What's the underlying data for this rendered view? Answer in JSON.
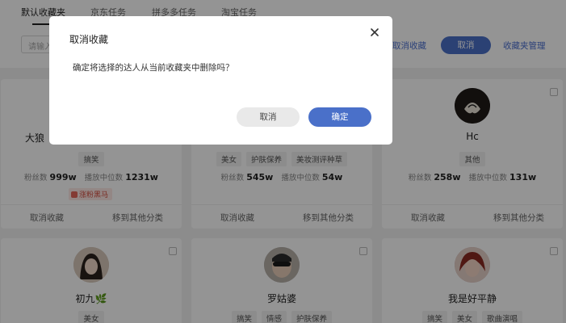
{
  "tabs": [
    {
      "label": "默认收藏夹"
    },
    {
      "label": "京东任务"
    },
    {
      "label": "拼多多任务"
    },
    {
      "label": "淘宝任务"
    }
  ],
  "toolbar": {
    "search_placeholder": "请输入",
    "cancel_fav_link": "取消收藏",
    "cancel_button": "取消",
    "manage_link": "收藏夹管理"
  },
  "labels": {
    "fans": "粉丝数",
    "median": "播放中位数",
    "cancel_fav": "取消收藏",
    "move": "移到其他分类"
  },
  "cards": [
    {
      "name": "大狼",
      "tags": [
        "搞笑"
      ],
      "fans": "999w",
      "median": "1231w",
      "badge": "涨粉黑马"
    },
    {
      "name": "",
      "tags": [
        "美女",
        "护肤保养",
        "美妆测评种草"
      ],
      "fans": "545w",
      "median": "54w"
    },
    {
      "name": "Hc",
      "tags": [
        "其他"
      ],
      "fans": "258w",
      "median": "131w"
    },
    {
      "name": "初九🌿",
      "tags": [
        "美女"
      ]
    },
    {
      "name": "罗姑婆",
      "tags": [
        "搞笑",
        "情感",
        "护肤保养"
      ]
    },
    {
      "name": "我是好平静",
      "tags": [
        "搞笑",
        "美女",
        "歌曲演唱"
      ]
    }
  ],
  "modal": {
    "title": "取消收藏",
    "message": "确定将选择的达人从当前收藏夹中删除吗？",
    "cancel": "取消",
    "confirm": "确定"
  },
  "colors": {
    "primary": "#4a70c9",
    "link": "#4a6fd0",
    "badge": "#d24a3c"
  }
}
